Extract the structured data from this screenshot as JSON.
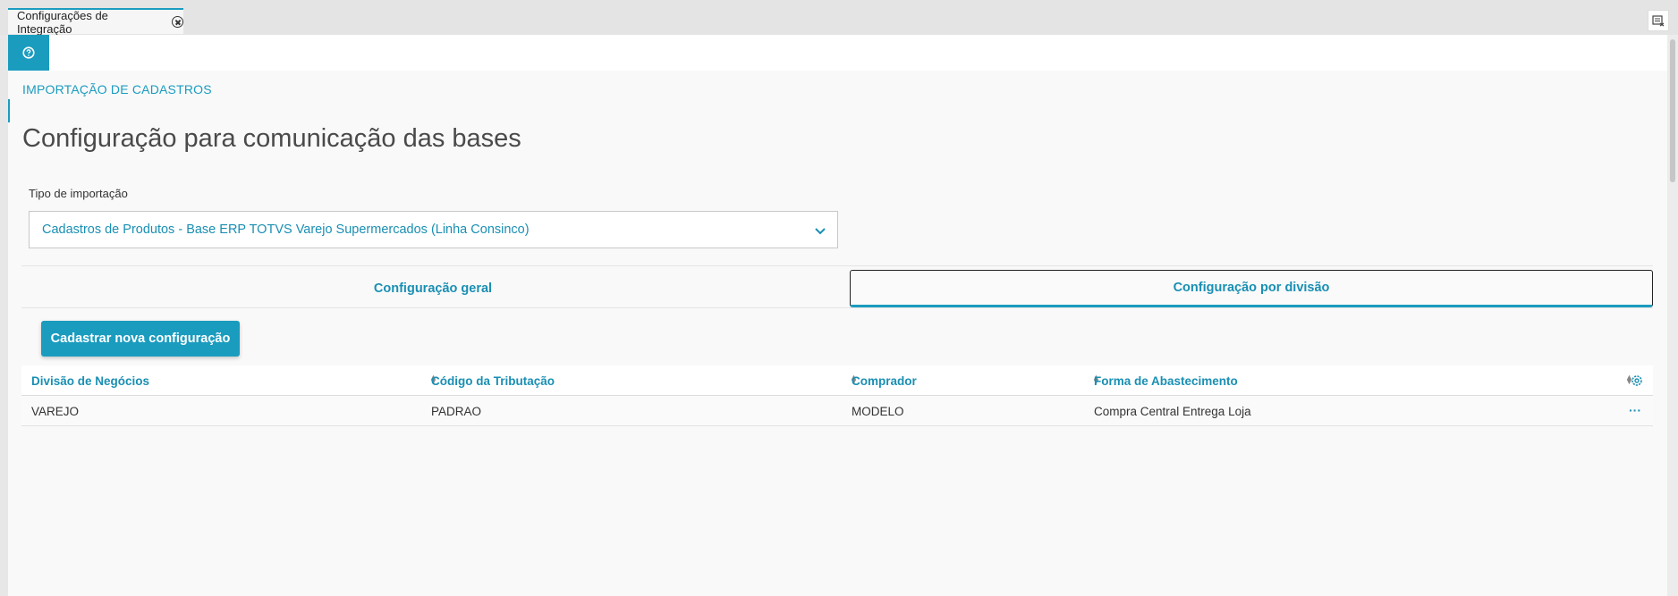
{
  "tabstrip": {
    "tab_label": "Configurações de Integração"
  },
  "breadcrumb": "IMPORTAÇÃO DE CADASTROS",
  "page_title": "Configuração para comunicação das bases",
  "import_type": {
    "label": "Tipo de importação",
    "selected": "Cadastros de Produtos - Base ERP TOTVS Varejo Supermercados (Linha Consinco)"
  },
  "tabs": [
    {
      "label": "Configuração geral",
      "active": false
    },
    {
      "label": "Configuração por divisão",
      "active": true
    }
  ],
  "new_config_button": "Cadastrar nova configuração",
  "table": {
    "columns": [
      "Divisão de Negócios",
      "Código da Tributação",
      "Comprador",
      "Forma de Abastecimento"
    ],
    "rows": [
      [
        "VAREJO",
        "PADRAO",
        "MODELO",
        "Compra Central Entrega Loja"
      ]
    ]
  },
  "colors": {
    "accent": "#1a9cbf",
    "link_text": "#1a8fb3",
    "title_text": "#4a4a4a"
  }
}
